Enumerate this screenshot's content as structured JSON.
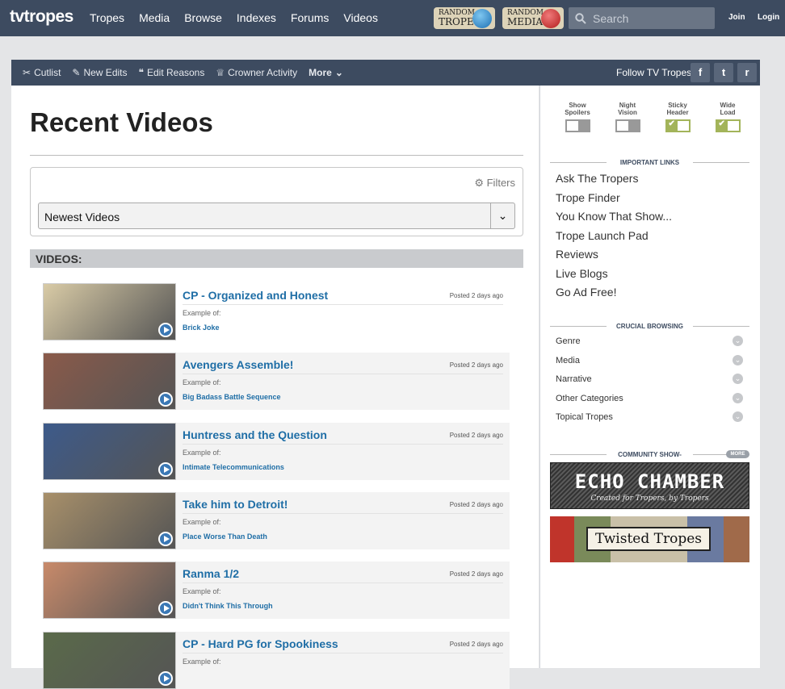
{
  "header": {
    "logo": "tvtropes",
    "nav": [
      "Tropes",
      "Media",
      "Browse",
      "Indexes",
      "Forums",
      "Videos"
    ],
    "random_trope": {
      "line1": "RANDOM",
      "line2": "TROPE"
    },
    "random_media": {
      "line1": "RANDOM",
      "line2": "MEDIA"
    },
    "search_placeholder": "Search",
    "join": "Join",
    "login": "Login"
  },
  "subbar": {
    "items": [
      "Cutlist",
      "New Edits",
      "Edit Reasons",
      "Crowner Activity",
      "More"
    ],
    "follow": "Follow TV Tropes",
    "social": [
      "f",
      "t",
      "r"
    ]
  },
  "main": {
    "title": "Recent Videos",
    "filters_label": "Filters",
    "select_value": "Newest Videos",
    "videos_header": "VIDEOS:",
    "example_of": "Example of:",
    "videos": [
      {
        "title": "CP - Organized and Honest",
        "posted": "Posted 2 days ago",
        "trope": "Brick Joke",
        "thumb_color": "#d9cba6"
      },
      {
        "title": "Avengers Assemble!",
        "posted": "Posted 2 days ago",
        "trope": "Big Badass Battle Sequence",
        "thumb_color": "#8a5a4a"
      },
      {
        "title": "Huntress and the Question",
        "posted": "Posted 2 days ago",
        "trope": "Intimate Telecommunications",
        "thumb_color": "#3d5a8a"
      },
      {
        "title": "Take him to Detroit!",
        "posted": "Posted 2 days ago",
        "trope": "Place Worse Than Death",
        "thumb_color": "#a8906a"
      },
      {
        "title": "Ranma 1/2",
        "posted": "Posted 2 days ago",
        "trope": "Didn't Think This Through",
        "thumb_color": "#c88a6a"
      },
      {
        "title": "CP - Hard PG for Spookiness",
        "posted": "Posted 2 days ago",
        "trope": "",
        "thumb_color": "#5a6a4a"
      }
    ]
  },
  "sidebar": {
    "toggles": [
      {
        "l1": "Show",
        "l2": "Spoilers",
        "on": false
      },
      {
        "l1": "Night",
        "l2": "Vision",
        "on": false
      },
      {
        "l1": "Sticky",
        "l2": "Header",
        "on": true
      },
      {
        "l1": "Wide",
        "l2": "Load",
        "on": true
      }
    ],
    "important_header": "IMPORTANT LINKS",
    "important_links": [
      "Ask The Tropers",
      "Trope Finder",
      "You Know That Show...",
      "Trope Launch Pad",
      "Reviews",
      "Live Blogs",
      "Go Ad Free!"
    ],
    "crucial_header": "CRUCIAL BROWSING",
    "crucial_links": [
      "Genre",
      "Media",
      "Narrative",
      "Other Categories",
      "Topical Tropes"
    ],
    "community_header": "COMMUNITY SHOW-",
    "more_badge": "MORE",
    "echo_title": "ECHO CHAMBER",
    "echo_sub": "Created for Tropers, by Tropers",
    "twisted_title": "Twisted Tropes"
  },
  "colors": {
    "header_bg": "#3d4b60",
    "link_blue": "#1f6ea6",
    "toggle_on": "#a3b45a"
  }
}
